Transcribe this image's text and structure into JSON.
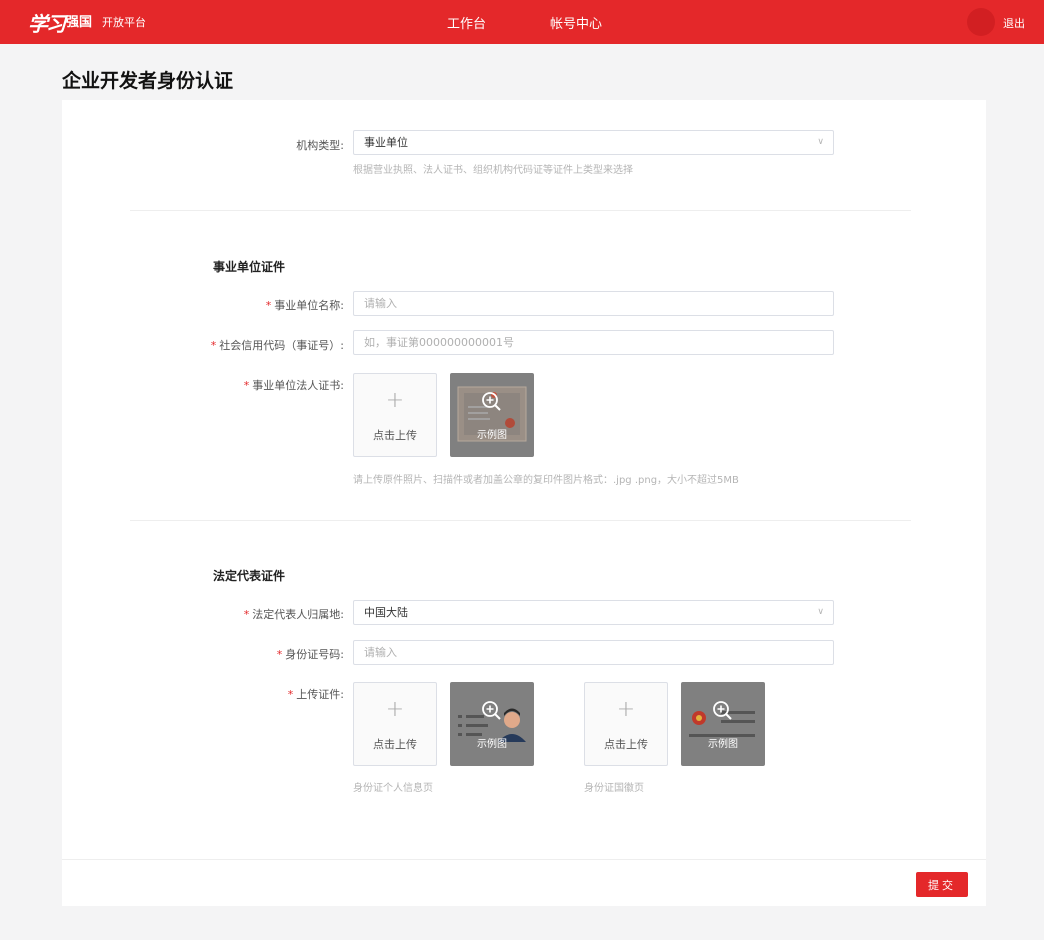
{
  "header": {
    "logo_text": "学习",
    "logo_mark": "强国",
    "logo_subtitle": "开放平台",
    "nav": [
      {
        "label": "工作台"
      },
      {
        "label": "帐号中心"
      }
    ],
    "logout_label": "退出",
    "brand_color": "#e4282a"
  },
  "page": {
    "title": "企业开发者身份认证"
  },
  "org_type": {
    "label": "机构类型:",
    "value": "事业单位",
    "hint": "根据营业执照、法人证书、组织机构代码证等证件上类型来选择"
  },
  "institution_section": {
    "title": "事业单位证件",
    "name_label": "事业单位名称:",
    "name_placeholder": "请输入",
    "credit_label": "社会信用代码（事证号）:",
    "credit_placeholder": "如，事证第000000000001号",
    "cert_label": "事业单位法人证书:",
    "upload_label": "点击上传",
    "example_label": "示例图",
    "upload_hint": "请上传原件照片、扫描件或者加盖公章的复印件图片格式：.jpg .png，大小不超过5MB"
  },
  "legal_rep_section": {
    "title": "法定代表证件",
    "region_label": "法定代表人归属地:",
    "region_value": "中国大陆",
    "id_label": "身份证号码:",
    "id_placeholder": "请输入",
    "upload_label_title": "上传证件:",
    "upload_label": "点击上传",
    "example_label": "示例图",
    "front_caption": "身份证个人信息页",
    "back_caption": "身份证国徽页"
  },
  "footer": {
    "submit_label": "提交"
  },
  "icons": {
    "dropdown": "chevron-down-icon",
    "plus": "plus-icon",
    "zoom": "zoom-in-icon"
  }
}
